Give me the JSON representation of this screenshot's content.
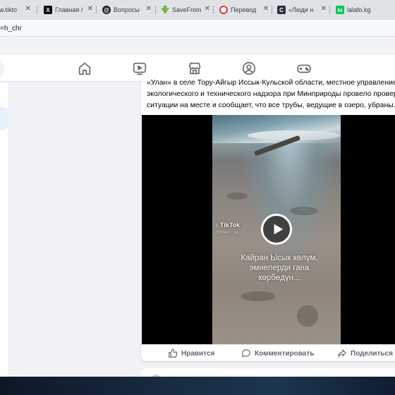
{
  "browser": {
    "tabs": [
      {
        "label": "www.tikto",
        "favicon": "tiktok-favicon",
        "color": "#ffffff"
      },
      {
        "label": "Главная /",
        "favicon": "x-favicon",
        "color": "#000000"
      },
      {
        "label": "Вопросы",
        "favicon": "threads-favicon",
        "color": "#000000"
      },
      {
        "label": "SaveFrom",
        "favicon": "savefrom-favicon",
        "color": "#7cb342"
      },
      {
        "label": "Перевод",
        "favicon": "translate-favicon",
        "color": "#e53935"
      },
      {
        "label": "«Люди н",
        "favicon": "c-favicon",
        "color": "#263238"
      },
      {
        "label": "lalafo.kg",
        "favicon": "lalafo-favicon",
        "color": "#00c853"
      }
    ],
    "address": "=h_chr"
  },
  "fb_nav": {
    "icons": [
      "home-icon",
      "video-icon",
      "marketplace-icon",
      "groups-icon",
      "gaming-icon"
    ]
  },
  "post": {
    "text_lines": [
      "«Улан» в селе Тору-Айгыр Иссык-Кульской области, местное управление Служ",
      "экологического и технического надзора при Минприроды провело проверку",
      "ситуации на месте и сообщает, что все трубы, ведущие в озеро, убраны."
    ],
    "video": {
      "watermark_brand": "TikTok",
      "watermark_user": "@timon__kg",
      "caption_lines": [
        "Кайран Ысык көлүм,",
        "эмнелерди гана",
        "көрбөдүн..."
      ]
    },
    "actions": {
      "like": "Нравится",
      "comment": "Комментировать",
      "share": "Поделиться"
    }
  },
  "colors": {
    "fb_bg": "#f0f2f5",
    "card": "#ffffff",
    "muted_text": "#65676b"
  }
}
